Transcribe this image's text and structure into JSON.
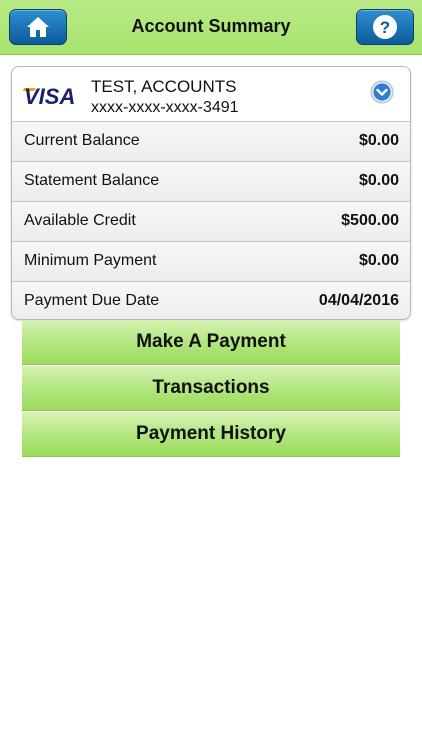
{
  "header": {
    "title": "Account Summary",
    "home_icon": "home-icon",
    "help_icon": "help-icon"
  },
  "account": {
    "brand": "VISA",
    "holder_name": "TEST, ACCOUNTS",
    "card_number": "xxxx-xxxx-xxxx-3491",
    "expand_icon": "chevron-down-circle-icon"
  },
  "summary": {
    "rows": [
      {
        "label": "Current Balance",
        "value": "$0.00"
      },
      {
        "label": "Statement Balance",
        "value": "$0.00"
      },
      {
        "label": "Available Credit",
        "value": "$500.00"
      },
      {
        "label": "Minimum Payment",
        "value": "$0.00"
      },
      {
        "label": "Payment Due Date",
        "value": "04/04/2016"
      }
    ]
  },
  "actions": {
    "make_payment": "Make A Payment",
    "transactions": "Transactions",
    "payment_history": "Payment History"
  },
  "colors": {
    "header_green": "#a7e36e",
    "button_blue": "#0b5b9b",
    "visa_blue": "#1a1f71",
    "visa_gold": "#f7a800"
  }
}
